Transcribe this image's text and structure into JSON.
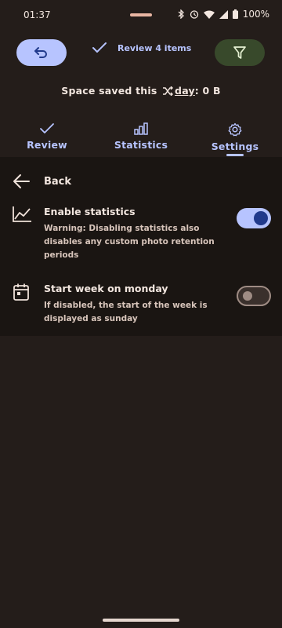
{
  "status_bar": {
    "time": "01:37",
    "battery": "100%",
    "icons": [
      "bluetooth-icon",
      "alarm-icon",
      "wifi-icon",
      "signal-icon",
      "battery-icon"
    ]
  },
  "top_bar": {
    "back_icon": "undo-icon",
    "review_check_icon": "check-icon",
    "review_label": "Review 4 items",
    "filter_icon": "filter-icon"
  },
  "space_saved": {
    "prefix": "Space saved this",
    "shuffle_icon": "shuffle-icon",
    "period": "day",
    "suffix": ": 0 B"
  },
  "tabs": [
    {
      "label": "Review",
      "icon": "check-icon"
    },
    {
      "label": "Statistics",
      "icon": "bar-chart-icon"
    },
    {
      "label": "Settings",
      "icon": "gear-icon",
      "selected": true
    }
  ],
  "settings": {
    "back_label": "Back",
    "items": [
      {
        "title": "Enable statistics",
        "description": "Warning: Disabling statistics also disables any custom photo retention periods",
        "icon": "trending-chart-icon",
        "enabled": true
      },
      {
        "title": "Start week on monday",
        "description": "If disabled, the start of the week is displayed as sunday",
        "icon": "calendar-icon",
        "enabled": false
      }
    ]
  },
  "colors": {
    "background": "#241d1a",
    "panel": "#1a1512",
    "accent": "#b7c4ff",
    "filter_bg": "#38492b",
    "toggle_on_knob": "#213a8c"
  }
}
